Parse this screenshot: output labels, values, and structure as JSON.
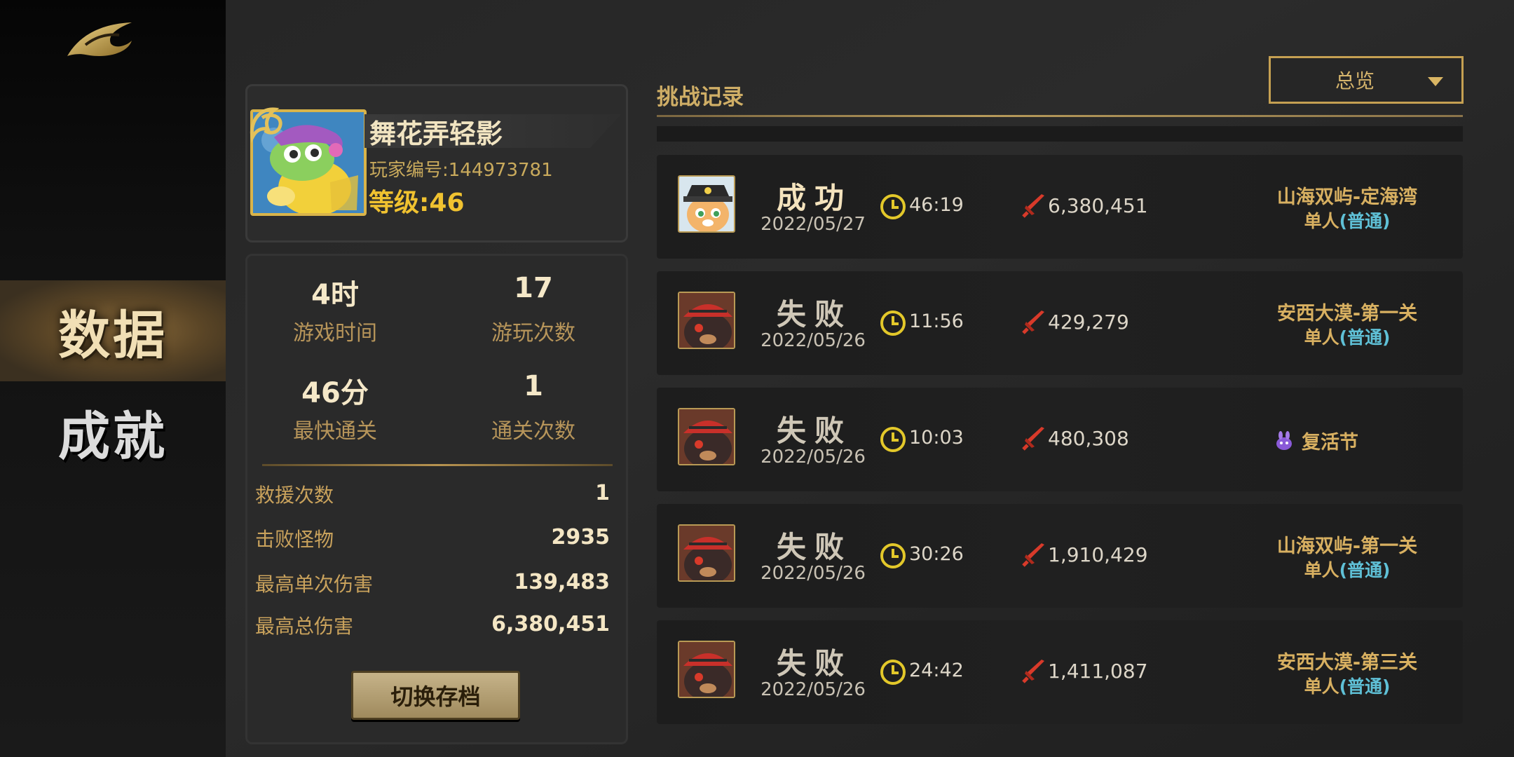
{
  "nav": {
    "data_label": "数据",
    "achievement_label": "成就"
  },
  "profile": {
    "name": "舞花弄轻影",
    "player_id": "玩家编号:144973781",
    "level": "等级:46"
  },
  "stats": {
    "play_time_value": "4时",
    "play_time_label": "游戏时间",
    "play_count_value": "17",
    "play_count_label": "游玩次数",
    "fastest_clear_value": "46分",
    "fastest_clear_label": "最快通关",
    "clear_count_value": "1",
    "clear_count_label": "通关次数",
    "details": [
      {
        "label": "救援次数",
        "value": "1"
      },
      {
        "label": "击败怪物",
        "value": "2935"
      },
      {
        "label": "最高单次伤害",
        "value": "139,483"
      },
      {
        "label": "最高总伤害",
        "value": "6,380,451"
      }
    ],
    "switch_save_label": "切换存档"
  },
  "records": {
    "title": "挑战记录",
    "filter_selected": "总览",
    "rows": [
      {
        "result": "成功",
        "date": "2022/05/27",
        "time": "46:19",
        "damage": "6,380,451",
        "stage": "山海双屿-定海湾",
        "mode": "单人",
        "difficulty": "(普通)",
        "avatar": "cat"
      },
      {
        "result": "失败",
        "date": "2022/05/26",
        "time": "11:56",
        "damage": "429,279",
        "stage": "安西大漠-第一关",
        "mode": "单人",
        "difficulty": "(普通)",
        "avatar": "bear"
      },
      {
        "result": "失败",
        "date": "2022/05/26",
        "time": "10:03",
        "damage": "480,308",
        "event": "复活节",
        "avatar": "bear"
      },
      {
        "result": "失败",
        "date": "2022/05/26",
        "time": "30:26",
        "damage": "1,910,429",
        "stage": "山海双屿-第一关",
        "mode": "单人",
        "difficulty": "(普通)",
        "avatar": "bear"
      },
      {
        "result": "失败",
        "date": "2022/05/26",
        "time": "24:42",
        "damage": "1,411,087",
        "stage": "安西大漠-第三关",
        "mode": "单人",
        "difficulty": "(普通)",
        "avatar": "bear"
      }
    ]
  },
  "colors": {
    "accent_gold": "#d8b061",
    "difficulty_cyan": "#5fc0d6",
    "level_yellow": "#f0c230",
    "damage_red": "#d83a2a"
  }
}
